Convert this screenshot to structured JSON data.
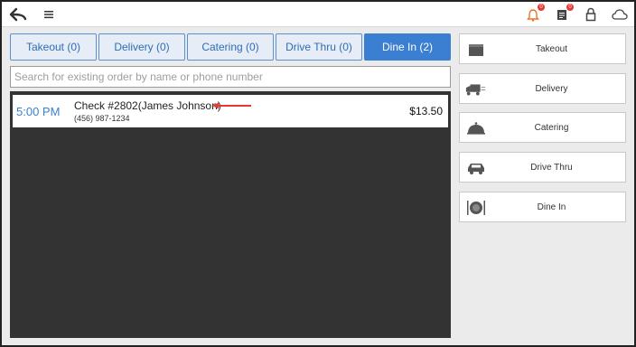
{
  "topbar": {
    "icons": [
      "back-arrow-icon",
      "menu-icon",
      "bell-icon",
      "orders-icon",
      "lock-icon",
      "cloud-icon"
    ],
    "bell_badge": "0",
    "orders_badge": "0",
    "accent": "#e53935"
  },
  "tabs": [
    {
      "label": "Takeout (0)",
      "active": false
    },
    {
      "label": "Delivery (0)",
      "active": false
    },
    {
      "label": "Catering (0)",
      "active": false
    },
    {
      "label": "Drive Thru (0)",
      "active": false
    },
    {
      "label": "Dine In (2)",
      "active": true
    }
  ],
  "search": {
    "placeholder": "Search for existing order by name or phone number",
    "value": ""
  },
  "orders": [
    {
      "time": "5:00 PM",
      "title": "Check #2802(James Johnson)",
      "phone": "(456) 987-1234",
      "amount": "$13.50"
    }
  ],
  "side_buttons": [
    {
      "label": "Takeout",
      "icon": "bag-icon"
    },
    {
      "label": "Delivery",
      "icon": "truck-icon"
    },
    {
      "label": "Catering",
      "icon": "cloche-icon"
    },
    {
      "label": "Drive Thru",
      "icon": "car-icon"
    },
    {
      "label": "Dine In",
      "icon": "plate-icon"
    }
  ],
  "colors": {
    "primary": "#3a7fd1",
    "list_background": "#333333",
    "annotation_arrow": "#e53935"
  }
}
